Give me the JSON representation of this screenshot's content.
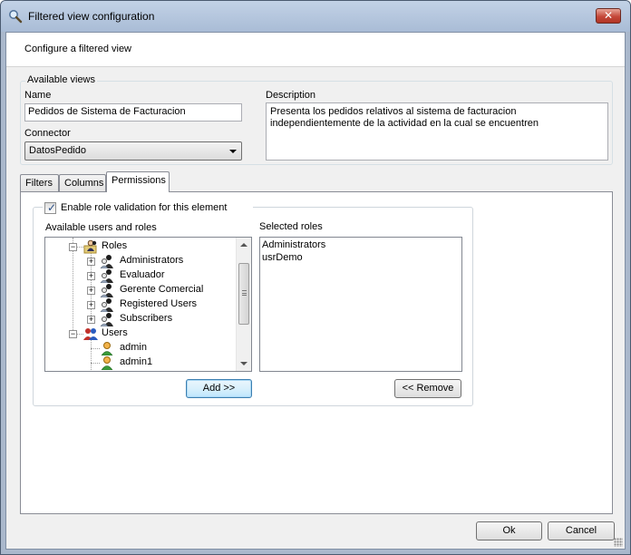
{
  "window": {
    "title": "Filtered view configuration",
    "close_glyph": "✕",
    "header": "Configure a filtered view"
  },
  "available_views": {
    "legend": "Available views",
    "name_label": "Name",
    "name_value": "Pedidos de Sistema de Facturacion",
    "description_label": "Description",
    "description_value": "Presenta los pedidos relativos al sistema de facturacion independientemente de la actividad en la cual se encuentren",
    "connector_label": "Connector",
    "connector_value": "DatosPedido"
  },
  "tabs": [
    {
      "label": "Filters",
      "active": false
    },
    {
      "label": "Columns",
      "active": false
    },
    {
      "label": "Permissions",
      "active": true
    }
  ],
  "permissions": {
    "enable_label": "Enable role validation for this element",
    "enable_checked": true,
    "available_label": "Available users and roles",
    "selected_label": "Selected roles",
    "tree": [
      {
        "label": "Roles",
        "level": 0,
        "kind": "roles-folder",
        "expanded": true
      },
      {
        "label": "Administrators",
        "level": 1,
        "kind": "role"
      },
      {
        "label": "Evaluador",
        "level": 1,
        "kind": "role"
      },
      {
        "label": "Gerente Comercial",
        "level": 1,
        "kind": "role"
      },
      {
        "label": "Registered Users",
        "level": 1,
        "kind": "role"
      },
      {
        "label": "Subscribers",
        "level": 1,
        "kind": "role"
      },
      {
        "label": "Users",
        "level": 0,
        "kind": "users-folder",
        "expanded": true
      },
      {
        "label": "admin",
        "level": 1,
        "kind": "user"
      },
      {
        "label": "admin1",
        "level": 1,
        "kind": "user"
      }
    ],
    "selected": [
      "Administrators",
      "usrDemo"
    ],
    "add_label": "Add >>",
    "remove_label": "<< Remove"
  },
  "footer": {
    "ok_label": "Ok",
    "cancel_label": "Cancel"
  },
  "icons": {
    "title": "magnifier-icon",
    "role": "user-group-icon",
    "user": "user-icon"
  }
}
